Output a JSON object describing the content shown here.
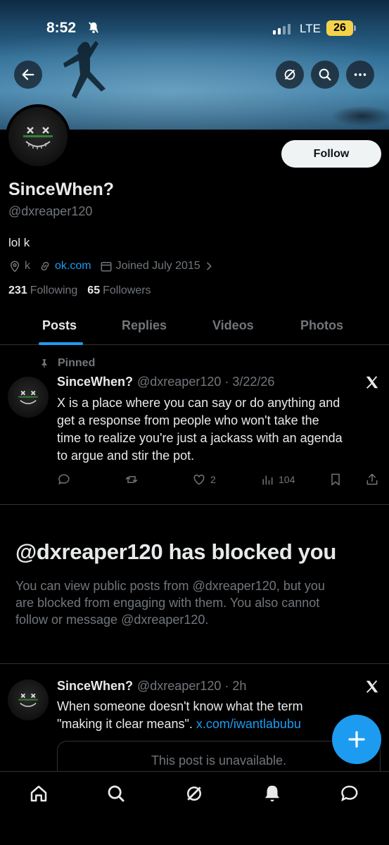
{
  "status_bar": {
    "time": "8:52",
    "network": "LTE",
    "battery": "26"
  },
  "banner_buttons": {
    "back": "arrow-left-icon",
    "grok": "grok-icon",
    "search": "search-icon",
    "more": "more-icon"
  },
  "profile": {
    "follow_label": "Follow",
    "display_name": "SinceWhen?",
    "handle": "@dxreaper120",
    "bio": "lol k",
    "location": "k",
    "website": "ok.com",
    "joined": "Joined July 2015",
    "following_count": "231",
    "following_label": "Following",
    "followers_count": "65",
    "followers_label": "Followers"
  },
  "tabs": [
    {
      "label": "Posts",
      "active": true
    },
    {
      "label": "Replies",
      "active": false
    },
    {
      "label": "Videos",
      "active": false
    },
    {
      "label": "Photos",
      "active": false
    }
  ],
  "pinned_post": {
    "pinned_label": "Pinned",
    "name": "SinceWhen?",
    "meta": "@dxreaper120 · 3/22/26",
    "lines": [
      "X is a place where you can say or do anything and",
      "get a response from people who won't take the",
      "time to realize you're just a jackass with an agenda",
      "to argue and stir the pot."
    ],
    "likes": "2",
    "views": "104"
  },
  "blocked": {
    "title": "@dxreaper120 has blocked you",
    "lines": [
      "You can view public posts from @dxreaper120, but you",
      "are blocked from engaging with them. You also cannot",
      "follow or message @dxreaper120."
    ]
  },
  "second_post": {
    "name": "SinceWhen?",
    "meta": "@dxreaper120 · 2h",
    "line1": "When someone doesn't know what the term",
    "line2_text": "\"making it clear means\". ",
    "line2_link": "x.com/iwantlabubu",
    "unavailable": "This post is unavailable."
  },
  "colors": {
    "accent": "#1d9bf0",
    "background": "#000000",
    "muted": "#71767b",
    "text": "#e7e9ea"
  }
}
